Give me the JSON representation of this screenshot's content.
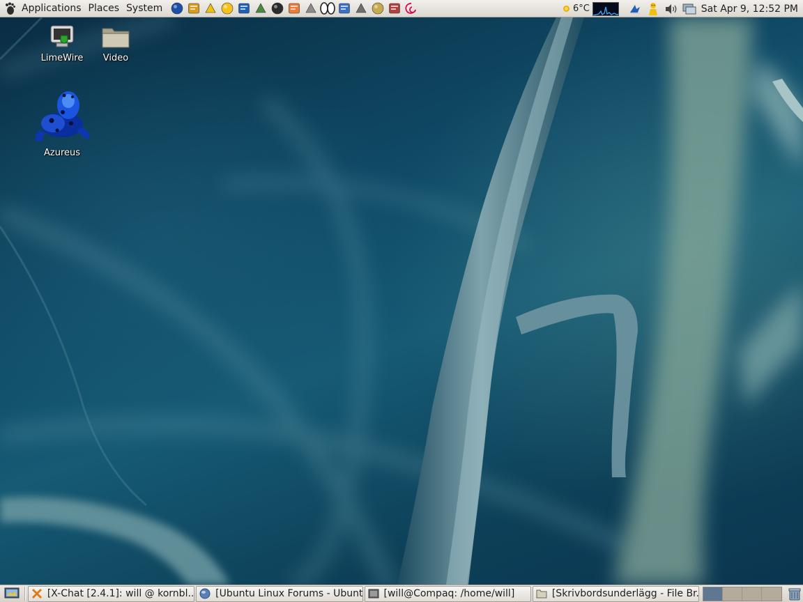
{
  "top_panel": {
    "menus": {
      "applications": "Applications",
      "places": "Places",
      "system": "System"
    },
    "launchers": [
      {
        "name": "globe-launcher-icon",
        "color": "#1b4fa8"
      },
      {
        "name": "compass-launcher-icon",
        "color": "#d99b1e"
      },
      {
        "name": "messenger-launcher-icon",
        "color": "#f0c010"
      },
      {
        "name": "smiley-launcher-icon",
        "color": "#f5c21b"
      },
      {
        "name": "bluefish-launcher-icon",
        "color": "#1f5fb5"
      },
      {
        "name": "ssh-launcher-icon",
        "color": "#4a8a3e"
      },
      {
        "name": "terminal-launcher-icon",
        "color": "#2b2b2b"
      },
      {
        "name": "office-launcher-icon",
        "color": "#ee7a35"
      },
      {
        "name": "calculator-launcher-icon",
        "color": "#8c8c8c"
      },
      {
        "name": "eyes-launcher-icon",
        "color": "#222222"
      },
      {
        "name": "text-editor-launcher-icon",
        "color": "#3a6fc4"
      },
      {
        "name": "screenshot-launcher-icon",
        "color": "#707070"
      },
      {
        "name": "notes-launcher-icon",
        "color": "#c9a94f"
      },
      {
        "name": "printer-launcher-icon",
        "color": "#b0413e"
      },
      {
        "name": "debian-launcher-icon",
        "color": "#d70751"
      }
    ],
    "weather": {
      "temperature": "6°C"
    },
    "clock": "Sat Apr  9, 12:52 PM"
  },
  "desktop": {
    "icons": [
      {
        "id": "limewire",
        "label": "LimeWire"
      },
      {
        "id": "video",
        "label": "Video"
      },
      {
        "id": "azureus",
        "label": "Azureus"
      }
    ]
  },
  "taskbar": {
    "tasks": [
      {
        "label": "[X-Chat [2.4.1]: will @ kornbl...",
        "icon": "xchat-icon"
      },
      {
        "label": "[Ubuntu Linux Forums - Ubunt...",
        "icon": "browser-icon"
      },
      {
        "label": "[will@Compaq: /home/will]",
        "icon": "terminal-icon"
      },
      {
        "label": "[Skrivbordsunderlägg - File Br...",
        "icon": "folder-icon"
      }
    ],
    "workspaces": 4,
    "active_workspace": 1
  },
  "colors": {
    "panel_bg": "#dcd8d1",
    "wallpaper": "#0f4a66",
    "workspace_active": "#5e7893"
  }
}
